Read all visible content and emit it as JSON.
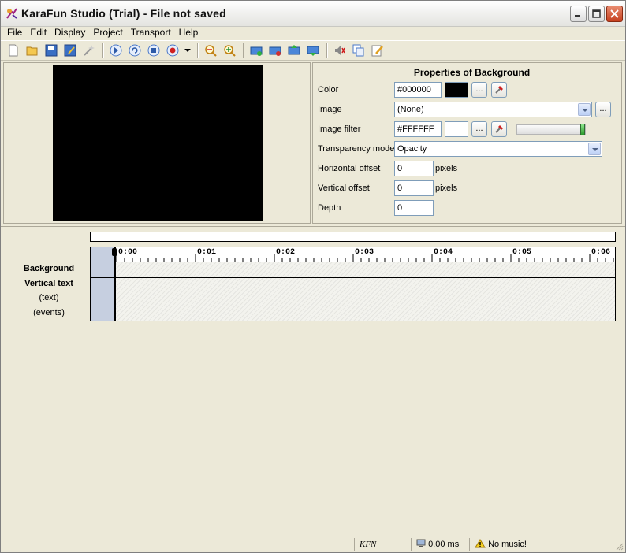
{
  "window": {
    "title": "KaraFun Studio (Trial) - File not saved",
    "controls": [
      "minimize-icon",
      "maximize-icon",
      "close-icon"
    ]
  },
  "menu": [
    {
      "label": "File"
    },
    {
      "label": "Edit"
    },
    {
      "label": "Display"
    },
    {
      "label": "Project"
    },
    {
      "label": "Transport"
    },
    {
      "label": "Help"
    }
  ],
  "toolbar": {
    "groups": [
      [
        "new-file-icon",
        "open-folder-icon",
        "save-icon",
        "save-as-icon",
        "wizard-icon"
      ],
      [
        "play-icon",
        "loop-icon",
        "stop-icon",
        "record-icon",
        "dropdown-arrow-icon"
      ],
      [
        "zoom-out-icon",
        "zoom-in-icon"
      ],
      [
        "add-track-icon",
        "delete-track-icon",
        "track-up-icon",
        "track-down-icon"
      ],
      [
        "volume-icon",
        "copy-icon",
        "edit-icon"
      ]
    ]
  },
  "properties": {
    "title": "Properties of Background",
    "color_label": "Color",
    "color_value": "#000000",
    "color_swatch": "#000000",
    "image_label": "Image",
    "image_value": "(None)",
    "image_filter_label": "Image filter",
    "image_filter_value": "#FFFFFF",
    "image_filter_swatch": "#FFFFFF",
    "image_filter_level": 1.0,
    "transparency_label": "Transparency mode",
    "transparency_value": "Opacity",
    "h_offset_label": "Horizontal offset",
    "h_offset_value": "0",
    "v_offset_label": "Vertical offset",
    "v_offset_value": "0",
    "depth_label": "Depth",
    "depth_value": "0",
    "pixels_unit": "pixels",
    "browse_label": "..."
  },
  "timeline": {
    "ticks": [
      "0:00",
      "0:01",
      "0:02",
      "0:03",
      "0:04",
      "0:05",
      "0:06"
    ],
    "tracks": {
      "background": "Background",
      "vertical_text": "Vertical text",
      "text": "(text)",
      "events": "(events)"
    }
  },
  "status": {
    "format": "KFN",
    "time": "0.00 ms",
    "music": "No music!"
  },
  "colors": {
    "chrome": "#ECE9D8",
    "gutter": "#c6cfe0",
    "accent_blue": "#316ac5"
  }
}
